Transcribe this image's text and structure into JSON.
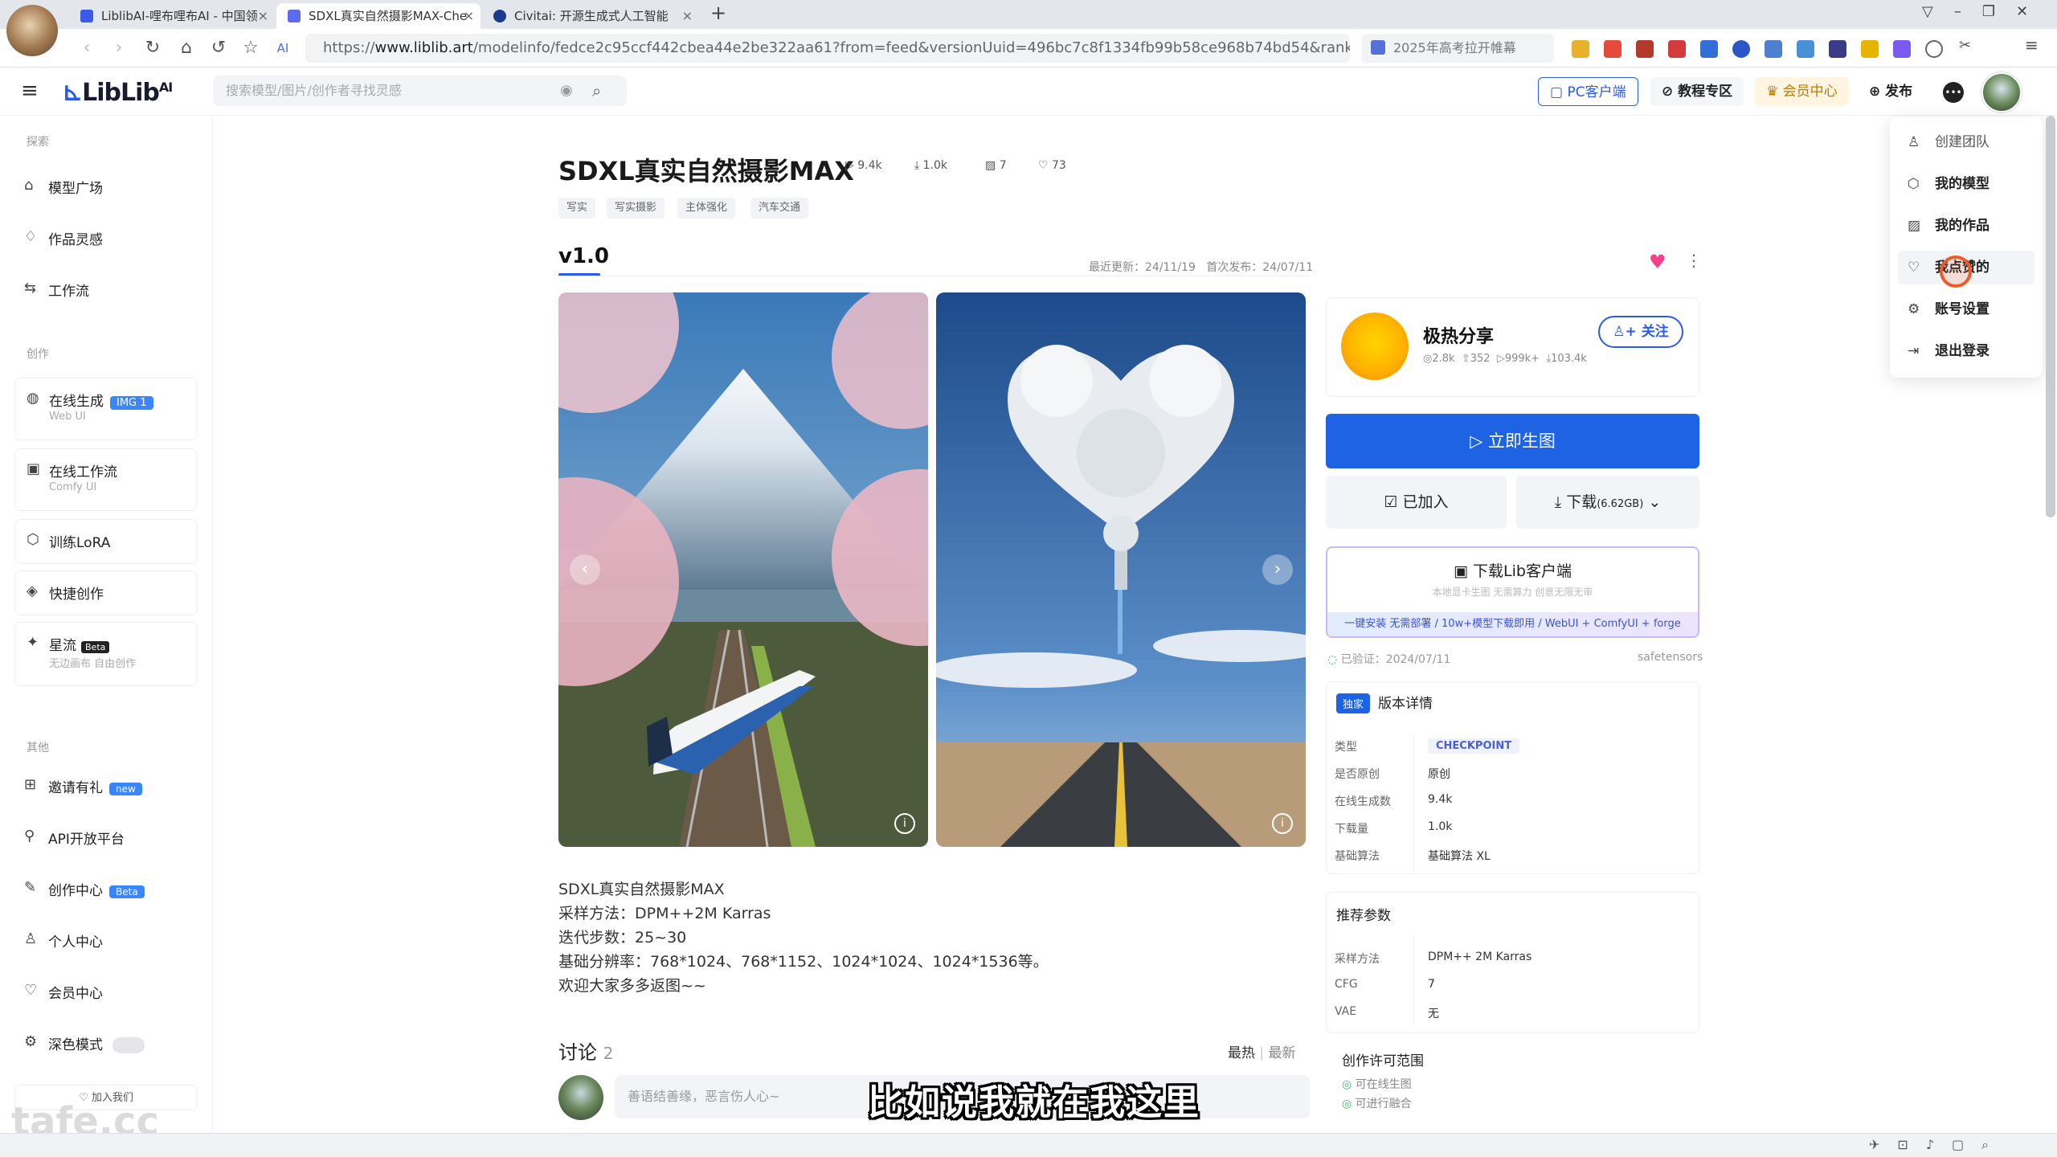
{
  "browser": {
    "tabs": [
      {
        "title": "LiblibAI-哩布哩布AI - 中国领",
        "active": false
      },
      {
        "title": "SDXL真实自然摄影MAX-Che",
        "active": true
      },
      {
        "title": "Civitai: 开源生成式人工智能",
        "active": false
      }
    ],
    "url_prefix": "https://",
    "url_domain": "www.liblib.art",
    "url_path": "/modelinfo/fedce2c95ccf442cbea44e2be322aa61?from=feed&versionUuid=496bc7c8f1334fb99b58ce968b74bd54&rankExpI",
    "search_placeholder": "2025年高考拉开帷幕"
  },
  "site": {
    "logo": "LibLib",
    "logo_sup": "AI",
    "search_placeholder": "搜索模型/图片/创作者寻找灵感",
    "header_buttons": {
      "pc_client": "PC客户端",
      "tutorial": "教程专区",
      "member": "会员中心",
      "publish": "发布"
    }
  },
  "sidebar": {
    "group_explore": "探索",
    "explore": [
      "模型广场",
      "作品灵感",
      "工作流"
    ],
    "group_create": "创作",
    "online_gen": {
      "label": "在线生成",
      "badge": "IMG 1",
      "sub": "Web UI"
    },
    "online_workflow": {
      "label": "在线工作流",
      "sub": "Comfy UI"
    },
    "train_lora": "训练LoRA",
    "quick_create": "快捷创作",
    "starflow": {
      "label": "星流",
      "badge": "Beta",
      "sub": "无边画布 自由创作"
    },
    "group_other": "其他",
    "invite": {
      "label": "邀请有礼",
      "badge": "new"
    },
    "api": "API开放平台",
    "creator_center": {
      "label": "创作中心",
      "badge": "Beta"
    },
    "personal": "个人中心",
    "member": "会员中心",
    "dark_mode": "深色模式",
    "join_us": "加入我们"
  },
  "model": {
    "title": "SDXL真实自然摄影MAX",
    "stats": {
      "runs": "9.4k",
      "downloads": "1.0k",
      "images": "7",
      "likes": "73"
    },
    "tags": [
      "写实",
      "写实摄影",
      "主体强化",
      "汽车交通"
    ],
    "version": "v1.0",
    "updated": "最近更新：24/11/19",
    "published": "首次发布：24/07/11",
    "description": [
      "SDXL真实自然摄影MAX",
      "采样方法：DPM++2M Karras",
      "迭代步数：25~30",
      "基础分辨率：768*1024、768*1152、1024*1024、1024*1536等。",
      "欢迎大家多多返图~~"
    ]
  },
  "discussion": {
    "title": "讨论",
    "count": "2",
    "sort_hot": "最热",
    "sort_sep": "|",
    "sort_new": "最新",
    "placeholder": "善语结善缘，恶言伤人心~"
  },
  "author": {
    "name": "极热分享",
    "follow": "关注",
    "stats": {
      "views": "2.8k",
      "likes": "352",
      "runs": "999k+",
      "downloads": "103.4k"
    }
  },
  "actions": {
    "generate": "立即生图",
    "added": "已加入",
    "download": "下载",
    "download_size": "(6.62GB)",
    "client_title": "下载Lib客户端",
    "client_sub": "本地显卡生图 无需算力 创意无限无审",
    "client_strip": "一键安装 无需部署 / 10w+模型下载即用 / WebUI + ComfyUI + forge",
    "verified": "已验证：2024/07/11",
    "format": "safetensors"
  },
  "version_details": {
    "exclusive": "独家",
    "title": "版本详情",
    "rows": [
      {
        "k": "类型",
        "v": "CHECKPOINT"
      },
      {
        "k": "是否原创",
        "v": "原创"
      },
      {
        "k": "在线生成数",
        "v": "9.4k"
      },
      {
        "k": "下载量",
        "v": "1.0k"
      },
      {
        "k": "基础算法",
        "v": "基础算法 XL"
      }
    ]
  },
  "recommended": {
    "title": "推荐参数",
    "rows": [
      {
        "k": "采样方法",
        "v": "DPM++ 2M Karras"
      },
      {
        "k": "CFG",
        "v": "7"
      },
      {
        "k": "VAE",
        "v": "无"
      }
    ]
  },
  "license": {
    "title": "创作许可范围",
    "items": [
      "可在线生图",
      "可进行融合"
    ]
  },
  "user_menu": [
    "创建团队",
    "我的模型",
    "我的作品",
    "我点赞的",
    "账号设置",
    "退出登录"
  ],
  "overlay": {
    "subtitle": "比如说我就在我这里",
    "watermark": "tafe.cc"
  }
}
